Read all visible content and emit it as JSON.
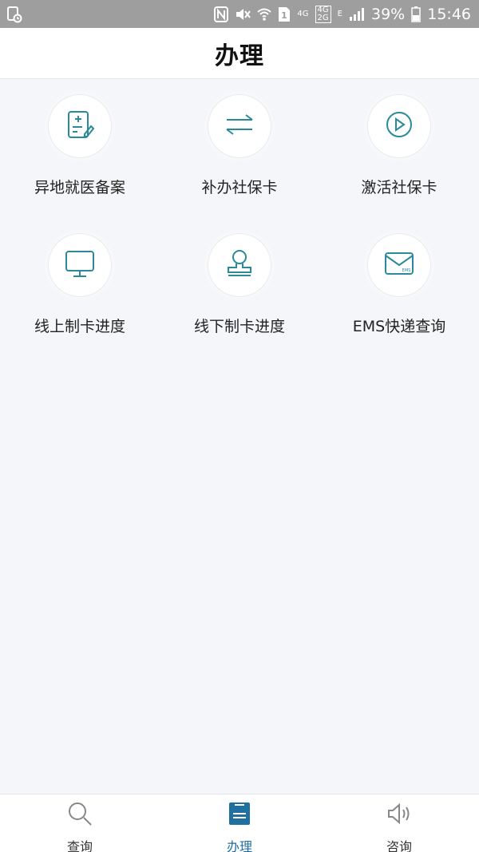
{
  "status_bar": {
    "network_top": "4G",
    "network_badge_top": "4G",
    "network_badge_bottom": "2G",
    "sim_label": "1",
    "data_type": "E",
    "battery": "39%",
    "time": "15:46"
  },
  "header": {
    "title": "办理"
  },
  "grid": {
    "items": [
      {
        "label": "异地就医备案",
        "icon": "medical-record-icon"
      },
      {
        "label": "补办社保卡",
        "icon": "swap-arrows-icon"
      },
      {
        "label": "激活社保卡",
        "icon": "play-circle-icon"
      },
      {
        "label": "线上制卡进度",
        "icon": "monitor-icon"
      },
      {
        "label": "线下制卡进度",
        "icon": "stamp-person-icon"
      },
      {
        "label": "EMS快递查询",
        "icon": "ems-envelope-icon",
        "icon_text": "EMS"
      }
    ]
  },
  "bottom_nav": {
    "items": [
      {
        "label": "查询",
        "icon": "search-icon"
      },
      {
        "label": "办理",
        "icon": "handle-document-icon",
        "active": true
      },
      {
        "label": "咨询",
        "icon": "speaker-icon"
      }
    ]
  },
  "colors": {
    "accent": "#1f6fa0",
    "icon_teal": "#2a8a9a",
    "status_bar_bg": "#9e9e9e",
    "page_bg": "#f4f6f9"
  }
}
